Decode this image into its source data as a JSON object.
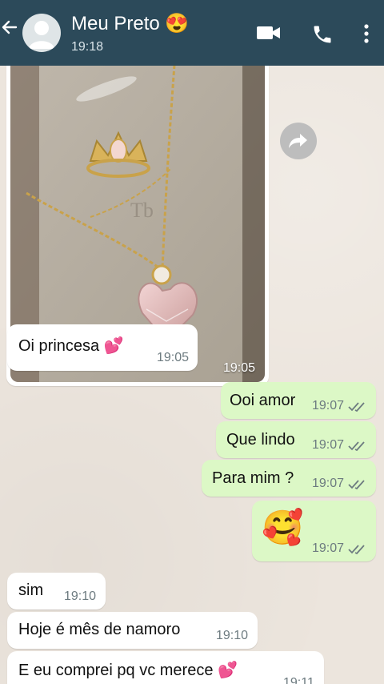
{
  "header": {
    "contact_name": "Meu Preto 😍",
    "last_seen": "19:18"
  },
  "icons": {
    "back": "back-arrow-icon",
    "avatar": "default-avatar-icon",
    "video": "video-call-icon",
    "call": "phone-icon",
    "menu": "more-vert-icon",
    "forward": "forward-icon"
  },
  "chat": {
    "photo_time": "19:05",
    "messages": [
      {
        "dir": "in",
        "text": "Oi princesa 💕",
        "time": "19:05"
      },
      {
        "dir": "out",
        "text": "Ooi amor",
        "time": "19:07"
      },
      {
        "dir": "out",
        "text": "Que lindo",
        "time": "19:07"
      },
      {
        "dir": "out",
        "text": "Para mim ?",
        "time": "19:07"
      },
      {
        "dir": "out",
        "text": "🥰",
        "time": "19:07"
      },
      {
        "dir": "in",
        "text": "sim",
        "time": "19:10"
      },
      {
        "dir": "in",
        "text": "Hoje é mês de namoro",
        "time": "19:10"
      },
      {
        "dir": "in",
        "text": "E eu comprei pq vc merece 💕",
        "time": "19:11"
      }
    ]
  },
  "colors": {
    "header_bg": "#2c4a5a",
    "chat_bg": "#ece5dd",
    "incoming_bubble": "#ffffff",
    "outgoing_bubble": "#dcf8c6",
    "read_ticks": "#6d7b80"
  }
}
